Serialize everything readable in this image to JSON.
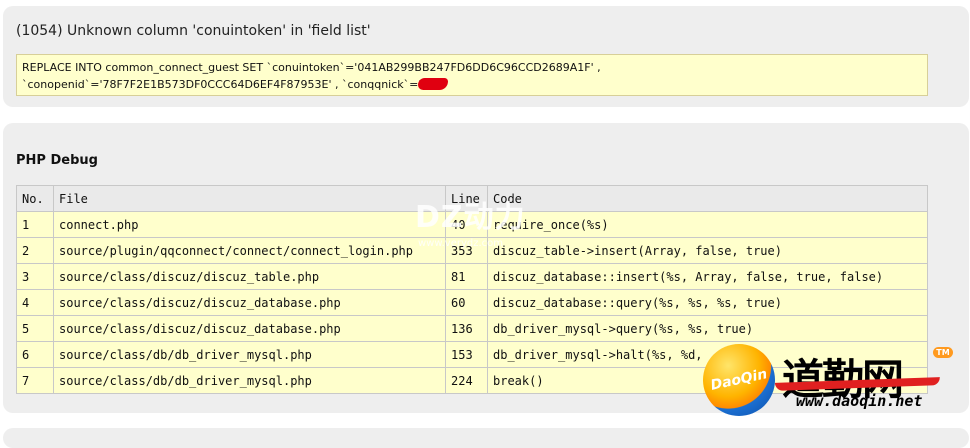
{
  "error": {
    "title": "(1054) Unknown column 'conuintoken' in 'field list'",
    "sql_line1": "REPLACE INTO common_connect_guest SET `conuintoken`='041AB299BB247FD6DD6C96CCD2689A1F' ,",
    "sql_line2": "`conopenid`='78F7F2E1B573DF0CCC64D6EF4F87953E' , `conqqnick`='"
  },
  "debug": {
    "title": "PHP Debug",
    "columns": [
      "No.",
      "File",
      "Line",
      "Code"
    ],
    "rows": [
      {
        "no": "1",
        "file": "connect.php",
        "line": "40",
        "code": "require_once(%s)"
      },
      {
        "no": "2",
        "file": "source/plugin/qqconnect/connect/connect_login.php",
        "line": "353",
        "code": "discuz_table->insert(Array, false, true)"
      },
      {
        "no": "3",
        "file": "source/class/discuz/discuz_table.php",
        "line": "81",
        "code": "discuz_database::insert(%s, Array, false, true, false)"
      },
      {
        "no": "4",
        "file": "source/class/discuz/discuz_database.php",
        "line": "60",
        "code": "discuz_database::query(%s, %s, %s, true)"
      },
      {
        "no": "5",
        "file": "source/class/discuz/discuz_database.php",
        "line": "136",
        "code": "db_driver_mysql->query(%s, %s, true)"
      },
      {
        "no": "6",
        "file": "source/class/db/db_driver_mysql.php",
        "line": "153",
        "code": "db_driver_mysql->halt(%s, %d,"
      },
      {
        "no": "7",
        "file": "source/class/db/db_driver_mysql.php",
        "line": "224",
        "code": "break()"
      }
    ]
  },
  "watermark": {
    "dz_text": "DZ动力",
    "dz_url": "www.verydz.com",
    "logo_circle_text": "DaoQin",
    "logo_cn": "道勤网",
    "logo_tm": "TM",
    "logo_url": "www.daoqin.net"
  },
  "colors": {
    "panel_bg": "#eeeeee",
    "highlight_bg": "#ffffcc",
    "redaction": "#e00010"
  }
}
